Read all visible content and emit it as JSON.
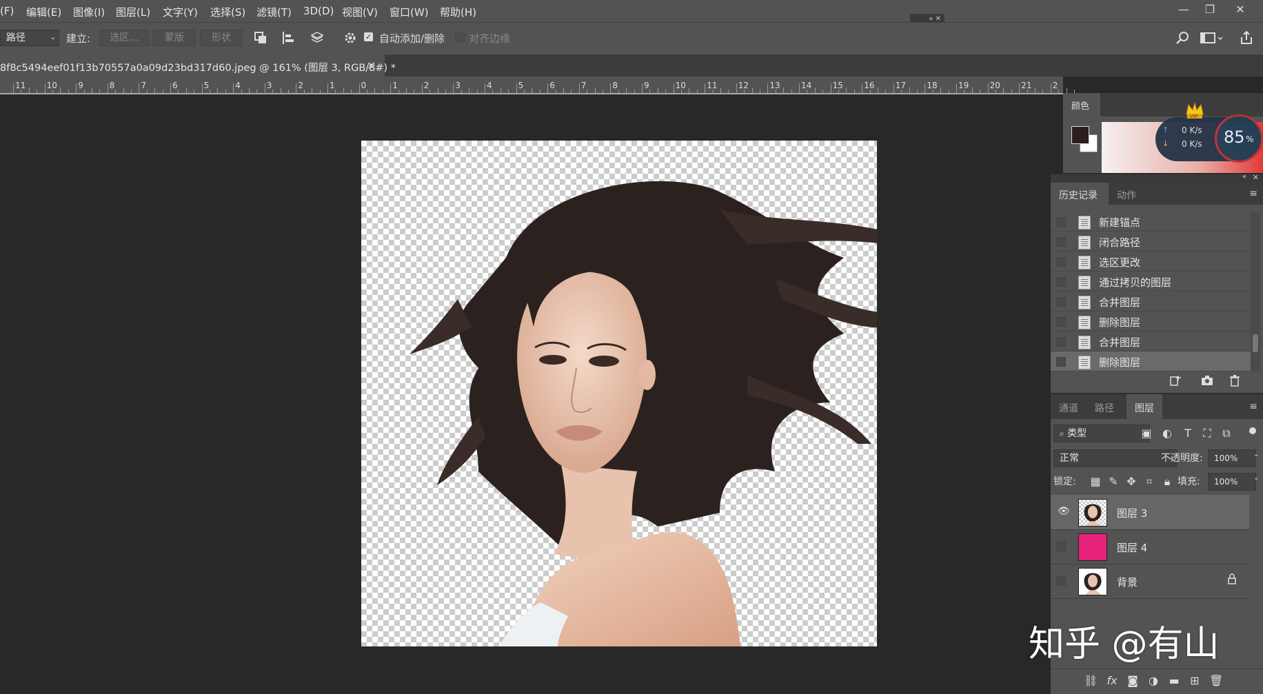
{
  "menu": {
    "items": [
      "(F)",
      "编辑(E)",
      "图像(I)",
      "图层(L)",
      "文字(Y)",
      "选择(S)",
      "滤镜(T)",
      "3D(D)",
      "视图(V)",
      "窗口(W)",
      "帮助(H)"
    ]
  },
  "window_controls": {
    "minimize": "—",
    "restore": "❐",
    "close": "✕"
  },
  "options_bar": {
    "tool_mode": "路径",
    "build_label": "建立:",
    "selection_btn": "选区...",
    "mask_btn": "蒙版",
    "shape_btn": "形状",
    "auto_add_delete_label": "自动添加/删除",
    "auto_add_delete_checked": true,
    "align_edges_label": "对齐边缘",
    "align_edges_checked": false
  },
  "document_tab": {
    "title": "8f8c5494eef01f13b70557a0a09d23bd317d60.jpeg  @  161% (图层 3, RGB/8#) *",
    "close": "×"
  },
  "ruler": {
    "labels": [
      "11",
      "10",
      "9",
      "8",
      "7",
      "6",
      "5",
      "4",
      "3",
      "2",
      "1",
      "0",
      "1",
      "2",
      "3",
      "4",
      "5",
      "6",
      "7",
      "8",
      "9",
      "10",
      "11",
      "12",
      "13",
      "14",
      "15",
      "16",
      "17",
      "18",
      "19",
      "20",
      "21",
      "2"
    ]
  },
  "color_panel": {
    "tab_label": "颜色",
    "foreground": "#2a1f1c",
    "background": "#ffffff"
  },
  "net_widget": {
    "up_speed": "0 K/s",
    "down_speed": "0 K/s",
    "percent": "85",
    "percent_unit": "%",
    "badge": "VIP"
  },
  "history_panel": {
    "tabs": [
      "历史记录",
      "动作"
    ],
    "items": [
      "新建锚点",
      "闭合路径",
      "选区更改",
      "通过拷贝的图层",
      "合并图层",
      "删除图层",
      "合并图层",
      "删除图层"
    ]
  },
  "layers_panel": {
    "tabs": [
      "通道",
      "路径",
      "图层"
    ],
    "filter_label": "类型",
    "blend_mode": "正常",
    "opacity_label": "不透明度:",
    "opacity_value": "100%",
    "lock_label": "锁定:",
    "fill_label": "填充:",
    "fill_value": "100%",
    "layers": [
      {
        "name": "图层 3",
        "visible": true,
        "thumb": "portrait-transparent"
      },
      {
        "name": "图层 4",
        "visible": false,
        "thumb": "solid-pink",
        "color": "#e8227a"
      },
      {
        "name": "背景",
        "visible": false,
        "thumb": "portrait",
        "locked": true
      }
    ]
  },
  "watermark": {
    "text": "知乎 @有山"
  }
}
